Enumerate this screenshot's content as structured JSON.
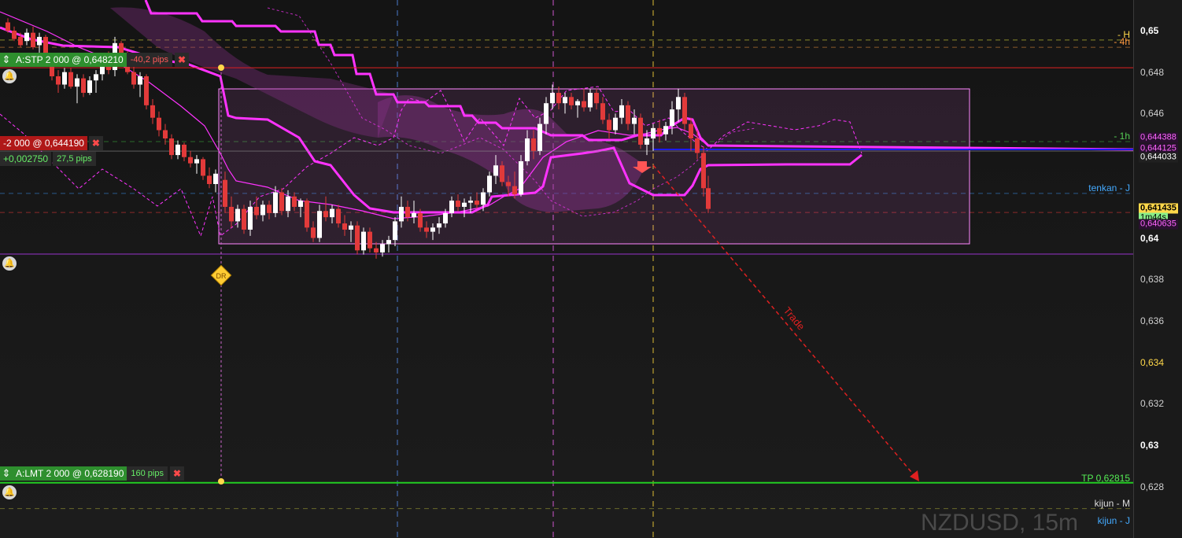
{
  "symbol_watermark": "NZDUSD, 15m",
  "price_axis": {
    "ticks": [
      {
        "label": "0,65",
        "price": 0.65,
        "style": "bold"
      },
      {
        "label": "0,648",
        "price": 0.648,
        "style": "normal"
      },
      {
        "label": "0,646",
        "price": 0.646,
        "style": "normal"
      },
      {
        "label": "0,64",
        "price": 0.64,
        "style": "bold"
      },
      {
        "label": "0,638",
        "price": 0.638,
        "style": "normal"
      },
      {
        "label": "0,636",
        "price": 0.636,
        "style": "normal"
      },
      {
        "label": "0,634",
        "price": 0.634,
        "style": "yellow"
      },
      {
        "label": "0,632",
        "price": 0.632,
        "style": "normal"
      },
      {
        "label": "0,63",
        "price": 0.63,
        "style": "bold"
      },
      {
        "label": "0,628",
        "price": 0.628,
        "style": "normal"
      }
    ],
    "tags": [
      {
        "label": "0,644388",
        "price": 0.64485,
        "fg": "#ff66ff",
        "bg": "#2a1030"
      },
      {
        "label": "0,644125",
        "price": 0.6443,
        "fg": "#ff66ff",
        "bg": "#2a1030"
      },
      {
        "label": "0,644033",
        "price": 0.64388,
        "fg": "#ffffff",
        "bg": "#202020"
      },
      {
        "label": "0,641435",
        "price": 0.64143,
        "fg": "#000000",
        "bg": "#ffd84a"
      },
      {
        "label": "1m44s",
        "price": 0.64095,
        "fg": "#000000",
        "bg": "#88ee88"
      },
      {
        "label": "0,640635",
        "price": 0.64065,
        "fg": "#ff66ff",
        "bg": "#2a1030"
      }
    ]
  },
  "orders": {
    "stop": {
      "label": "A:STP  2 000 @ 0,648210",
      "pips": "-40,2 pips",
      "price": 0.64821
    },
    "limit": {
      "label": "A:LMT  2 000 @ 0,628190",
      "pips": "160 pips",
      "price": 0.62819
    },
    "position": {
      "label": "-2 000 @ 0,644190",
      "pnl": "+0,002750",
      "pips": "27,5 pips",
      "price": 0.64419
    }
  },
  "level_labels": [
    {
      "label": "- H",
      "price": 0.64955,
      "color": "#ffd84a"
    },
    {
      "label": "- 4h",
      "price": 0.6492,
      "color": "#ff9940"
    },
    {
      "label": "- 1h",
      "price": 0.64465,
      "color": "#55cc55"
    },
    {
      "label": "tenkan - J",
      "price": 0.64215,
      "color": "#44aaff"
    },
    {
      "label": "TP 0,62815",
      "price": 0.62815,
      "color": "#55ee55"
    },
    {
      "label": "kijun - M",
      "price": 0.62694,
      "color": "#dddddd"
    },
    {
      "label": "kijun - J",
      "price": 0.6261,
      "color": "#44aaff"
    }
  ],
  "annotations": {
    "trade_arrow_label": "Trade",
    "dr_marker": "DR"
  },
  "colors": {
    "up": "#ffffff",
    "down": "#e23a3a",
    "ichimoku": "#ff33ff",
    "cloud": "#6a2a6a",
    "box": "#ff88ff",
    "tp": "#22cc22",
    "position_line": "#1a1aee",
    "stop_line": "#e02020"
  },
  "icons": [
    "updown-arrow-icon",
    "close-icon",
    "bell-icon",
    "down-arrow-icon",
    "diamond-icon"
  ]
}
